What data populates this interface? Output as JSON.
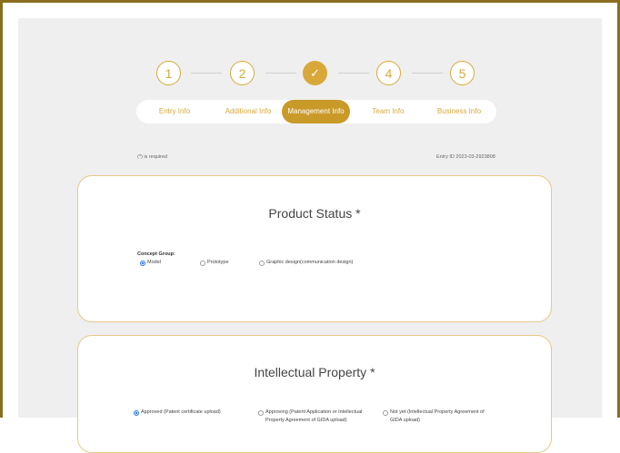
{
  "steps": [
    "1",
    "2",
    "✓",
    "4",
    "5"
  ],
  "tabs": [
    "Entry Info",
    "Additional Info",
    "Management Info",
    "Team Info",
    "Business Info"
  ],
  "required_note": "(*) is required",
  "entry_id": "Entry ID 2023-03-2923808",
  "product_status": {
    "title": "Product Status *",
    "group_label": "Concept Group:",
    "options": [
      "Model",
      "Prototype",
      "Graphic design(communication design)"
    ],
    "selected": "Model"
  },
  "intellectual_property": {
    "title": "Intellectual Property *",
    "options": [
      "Approved (Patent certificate upload)",
      "Approving (Patent Application or Intellectual Property Agreement of GIDA upload)",
      "Not yet (Intellectual Property Agreement of GIDA upload)"
    ],
    "selected": "Approved (Patent certificate upload)"
  }
}
